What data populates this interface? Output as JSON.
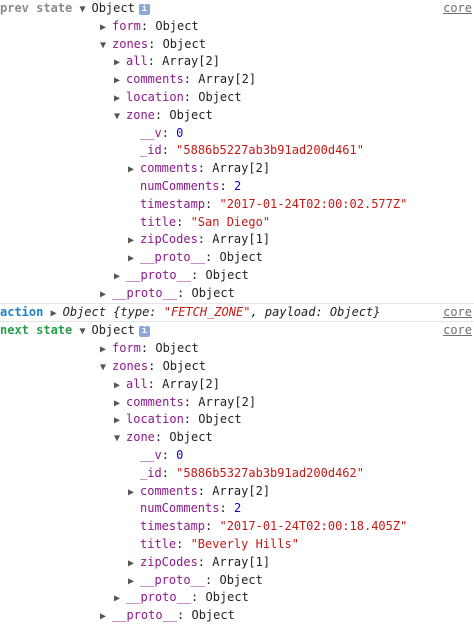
{
  "source_link": "core",
  "prev": {
    "label": "prev state",
    "root": "Object",
    "info": "i",
    "form": {
      "key": "form",
      "value": "Object"
    },
    "zones": {
      "key": "zones",
      "value": "Object"
    },
    "all": {
      "key": "all",
      "value": "Array[2]"
    },
    "comments": {
      "key": "comments",
      "value": "Array[2]"
    },
    "location": {
      "key": "location",
      "value": "Object"
    },
    "zone": {
      "key": "zone",
      "value": "Object"
    },
    "v": {
      "key": "__v",
      "value": "0"
    },
    "id": {
      "key": "_id",
      "value": "\"5886b5227ab3b91ad200d461\""
    },
    "zcomments": {
      "key": "comments",
      "value": "Array[2]"
    },
    "numComments": {
      "key": "numComments",
      "value": "2"
    },
    "timestamp": {
      "key": "timestamp",
      "value": "\"2017-01-24T02:00:02.577Z\""
    },
    "title": {
      "key": "title",
      "value": "\"San Diego\""
    },
    "zipCodes": {
      "key": "zipCodes",
      "value": "Array[1]"
    },
    "zproto": {
      "key": "__proto__",
      "value": "Object"
    },
    "zonesproto": {
      "key": "__proto__",
      "value": "Object"
    },
    "rootproto": {
      "key": "__proto__",
      "value": "Object"
    }
  },
  "action": {
    "label": "action",
    "text_prefix": "Object {type: ",
    "type_value": "\"FETCH_ZONE\"",
    "text_suffix": ", payload: Object}"
  },
  "next": {
    "label": "next state",
    "root": "Object",
    "info": "i",
    "form": {
      "key": "form",
      "value": "Object"
    },
    "zones": {
      "key": "zones",
      "value": "Object"
    },
    "all": {
      "key": "all",
      "value": "Array[2]"
    },
    "comments": {
      "key": "comments",
      "value": "Array[2]"
    },
    "location": {
      "key": "location",
      "value": "Object"
    },
    "zone": {
      "key": "zone",
      "value": "Object"
    },
    "v": {
      "key": "__v",
      "value": "0"
    },
    "id": {
      "key": "_id",
      "value": "\"5886b5327ab3b91ad200d462\""
    },
    "zcomments": {
      "key": "comments",
      "value": "Array[2]"
    },
    "numComments": {
      "key": "numComments",
      "value": "2"
    },
    "timestamp": {
      "key": "timestamp",
      "value": "\"2017-01-24T02:00:18.405Z\""
    },
    "title": {
      "key": "title",
      "value": "\"Beverly Hills\""
    },
    "zipCodes": {
      "key": "zipCodes",
      "value": "Array[1]"
    },
    "zproto": {
      "key": "__proto__",
      "value": "Object"
    },
    "zonesproto": {
      "key": "__proto__",
      "value": "Object"
    },
    "rootproto": {
      "key": "__proto__",
      "value": "Object"
    }
  },
  "icons": {
    "expanded": "▼",
    "collapsed": "▶"
  }
}
